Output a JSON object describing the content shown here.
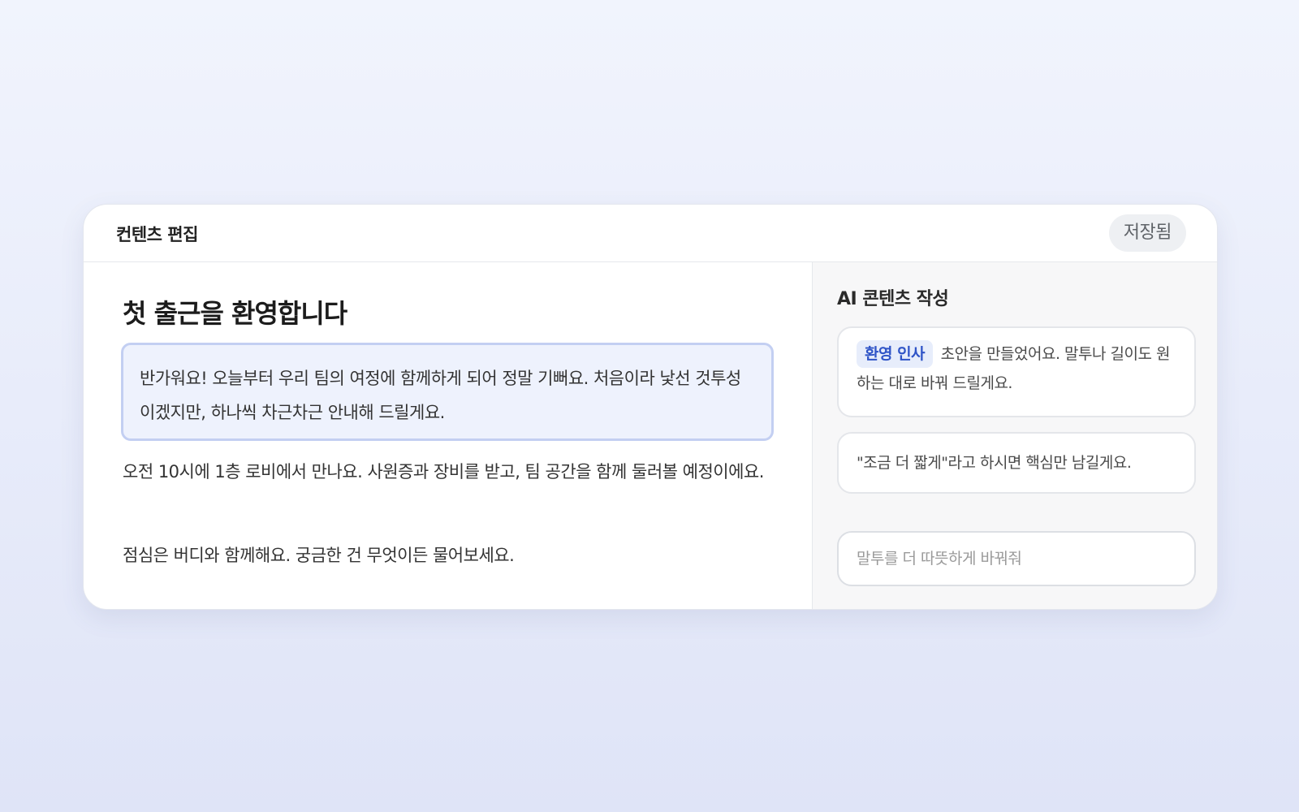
{
  "header": {
    "title": "컨텐츠 편집",
    "status": "저장됨"
  },
  "editor": {
    "title": "첫 출근을 환영합니다",
    "paragraphs": [
      "반가워요! 오늘부터 우리 팀의 여정에 함께하게 되어 정말 기뻐요. 처음이라 낯선 것투성이겠지만, 하나씩 차근차근 안내해 드릴게요.",
      "오전 10시에 1층 로비에서 만나요. 사원증과 장비를 받고, 팀 공간을 함께 둘러볼 예정이에요.",
      "점심은 버디와 함께해요. 궁금한 건 무엇이든 물어보세요."
    ]
  },
  "ai_panel": {
    "title": "AI 콘텐츠 작성",
    "messages": [
      {
        "tag": "환영 인사",
        "text": "초안을 만들었어요. 말투나 길이도 원하는 대로 바꿔 드릴게요."
      },
      {
        "text": "\"조금 더 짧게\"라고 하시면 핵심만 남길게요."
      }
    ],
    "input": {
      "value": "",
      "placeholder": "말투를 더 따뜻하게 바꿔줘"
    }
  },
  "colors": {
    "accent": "#2f54c7",
    "selection_bg": "#eef2fd",
    "selection_border": "#c3cff2"
  }
}
